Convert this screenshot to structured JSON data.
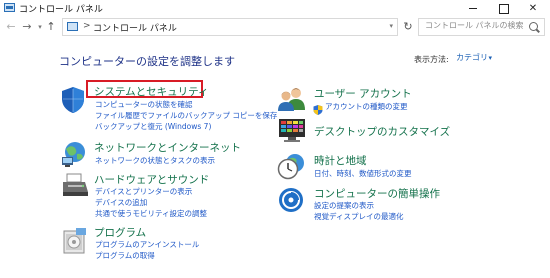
{
  "window": {
    "title": "コントロール パネル",
    "controls": {
      "minimize": "minimize",
      "maximize": "maximize",
      "close": "✕"
    }
  },
  "nav": {
    "back": "←",
    "forward": "→",
    "dropdown": "▾",
    "up": "↑",
    "address_separator": ">",
    "address_path": "コントロール パネル",
    "address_dropdown": "▾",
    "refresh": "↻",
    "search_placeholder": "コントロール パネルの検索"
  },
  "main": {
    "heading": "コンピューターの設定を調整します",
    "view_by_label": "表示方法:",
    "view_by_value": "カテゴリ"
  },
  "categories_left": [
    {
      "title": "システムとセキュリティ",
      "icon": "shield-icon",
      "links": [
        "コンピューターの状態を確認",
        "ファイル履歴でファイルのバックアップ コピーを保存",
        "バックアップと復元 (Windows 7)"
      ]
    },
    {
      "title": "ネットワークとインターネット",
      "icon": "network-globe-icon",
      "links": [
        "ネットワークの状態とタスクの表示"
      ]
    },
    {
      "title": "ハードウェアとサウンド",
      "icon": "printer-icon",
      "links": [
        "デバイスとプリンターの表示",
        "デバイスの追加",
        "共通で使うモビリティ設定の調整"
      ]
    },
    {
      "title": "プログラム",
      "icon": "programs-icon",
      "links": [
        "プログラムのアンインストール",
        "プログラムの取得"
      ]
    }
  ],
  "categories_right": [
    {
      "title": "ユーザー アカウント",
      "icon": "users-icon",
      "links": [
        "アカウントの種類の変更"
      ]
    },
    {
      "title": "デスクトップのカスタマイズ",
      "icon": "desktop-palette-icon",
      "links": []
    },
    {
      "title": "時計と地域",
      "icon": "clock-icon",
      "links": [
        "日付、時刻、数値形式の変更"
      ]
    },
    {
      "title": "コンピューターの簡単操作",
      "icon": "ease-of-access-icon",
      "links": [
        "設定の提案の表示",
        "視覚ディスプレイの最適化"
      ]
    }
  ],
  "colors": {
    "category_title": "#13714b",
    "link": "#1f58c7",
    "heading": "#1e3287",
    "highlight_border": "#d81c26"
  }
}
